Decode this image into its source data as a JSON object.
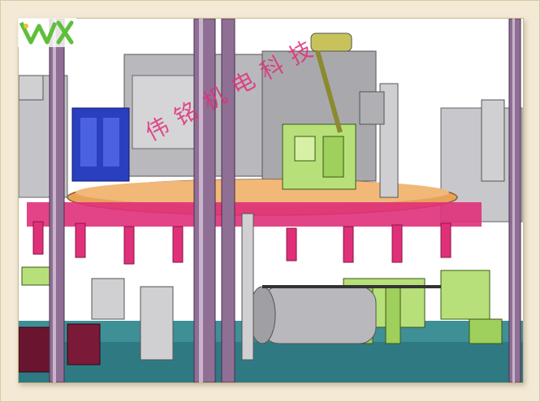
{
  "image": {
    "type": "3D CAD assembly render of a rotary automation machine",
    "watermark_text": "伟铭机电科技",
    "logo_mark": "logo-mark"
  },
  "colors": {
    "background_frame": "#f3ead6",
    "machine_gray": "#b9b9bd",
    "column_purple": "#8f6f93",
    "fixture_magenta": "#e0307a",
    "turntable_orange": "#e8a25c",
    "tooling_green": "#b8e07a",
    "block_blue": "#2a3fbf",
    "floor_teal": "#3f8f96"
  }
}
